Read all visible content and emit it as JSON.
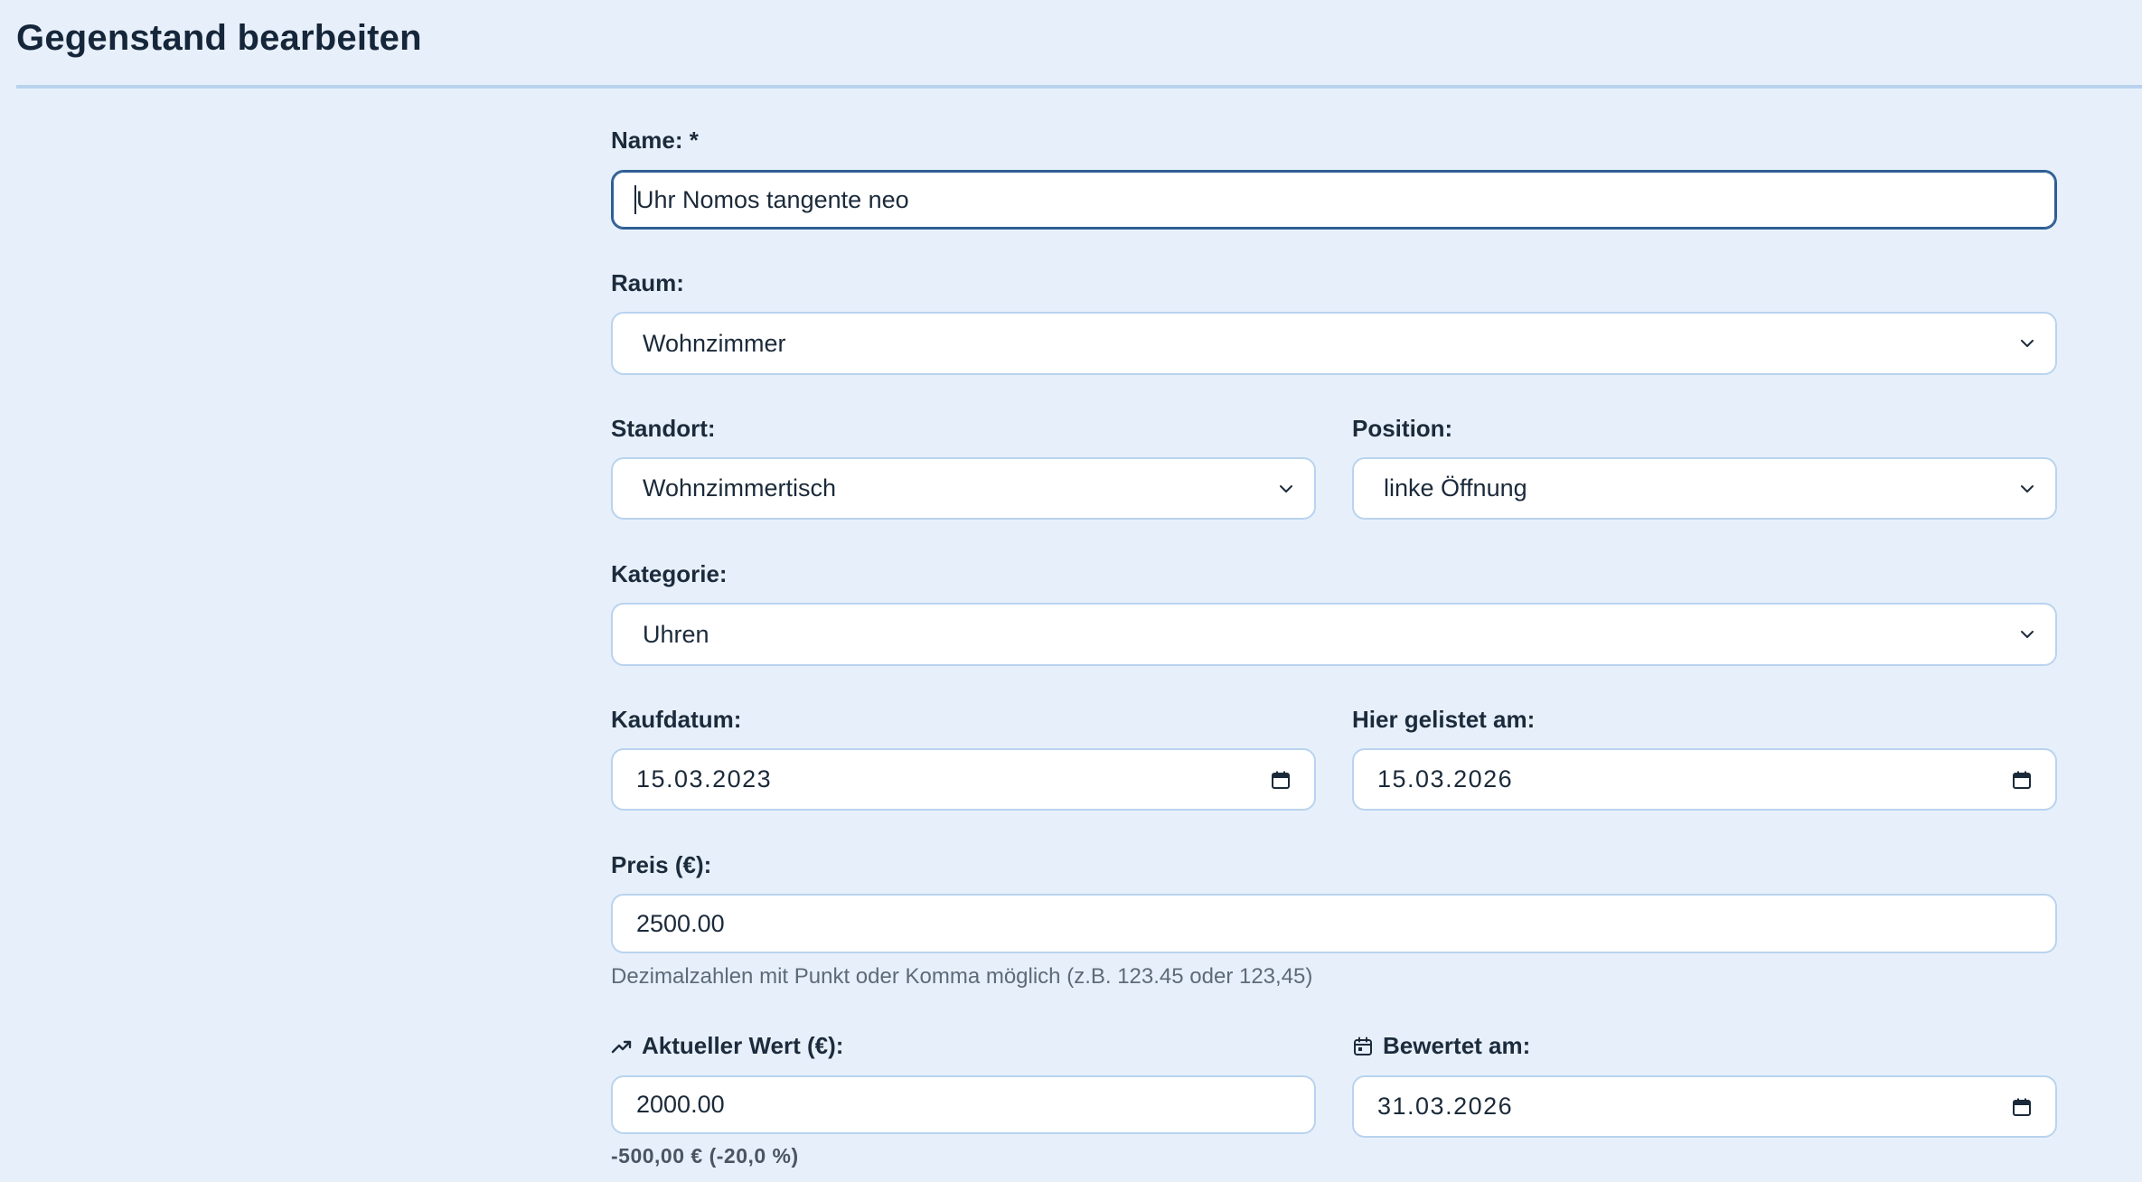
{
  "page": {
    "title": "Gegenstand bearbeiten"
  },
  "form": {
    "name": {
      "label": "Name: *",
      "value": "Uhr Nomos tangente neo"
    },
    "raum": {
      "label": "Raum:",
      "value": "Wohnzimmer"
    },
    "standort": {
      "label": "Standort:",
      "value": "Wohnzimmertisch"
    },
    "position": {
      "label": "Position:",
      "value": "linke Öffnung"
    },
    "kategorie": {
      "label": "Kategorie:",
      "value": "Uhren"
    },
    "kaufdatum": {
      "label": "Kaufdatum:",
      "value": "15.03.2023"
    },
    "gelistet": {
      "label": "Hier gelistet am:",
      "value": "15.03.2026"
    },
    "preis": {
      "label": "Preis (€):",
      "value": "2500.00",
      "hint": "Dezimalzahlen mit Punkt oder Komma möglich (z.B. 123.45 oder 123,45)"
    },
    "wert": {
      "label": "Aktueller Wert (€):",
      "value": "2000.00",
      "delta": "-500,00 € (-20,0 %)",
      "icon": "trending-up-icon"
    },
    "bewertet": {
      "label": "Bewertet am:",
      "value": "31.03.2026",
      "icon": "calendar-icon"
    }
  },
  "colors": {
    "background": "#e7f0fa",
    "border": "#b9d3ef",
    "focus_border": "#2f5e94",
    "text": "#1b2a3a",
    "hint_text": "#5d6a78"
  }
}
